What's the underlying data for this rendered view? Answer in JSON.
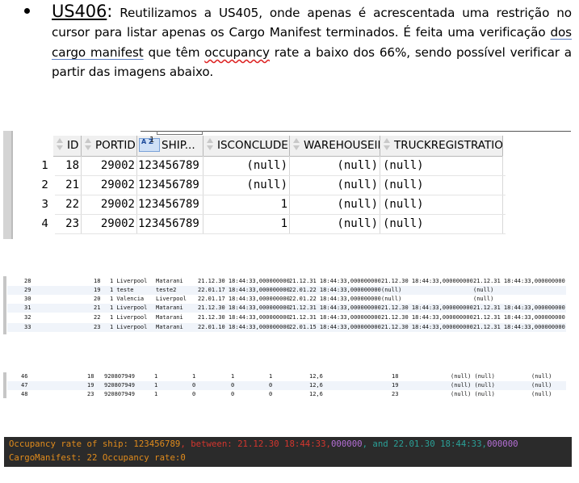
{
  "paragraph": {
    "story_id": "US406",
    "colon": ":",
    "t1": " Reutilizamos a US405, onde apenas é acrescentada uma restrição no cursor para listar apenas os Cargo Manifest terminados. É feita uma verificação ",
    "u1": "dos cargo manifest",
    "t2": " que têm ",
    "u2": "occupancy",
    "t3": " rate a baixo dos 66%, sendo possível verificar a partir das imagens abaixo."
  },
  "grid1": {
    "headers": [
      "ID",
      "PORTID",
      "SHIP...",
      "ISCONCLUDED",
      "WAREHOUSEID",
      "TRUCKREGISTRATION"
    ],
    "sort_badge": "A Z",
    "sort_index": "1",
    "rows": [
      {
        "num": "1",
        "id": "18",
        "portid": "29002",
        "ship": "123456789",
        "isconcluded": "(null)",
        "warehouseid": "(null)",
        "truck": "(null)"
      },
      {
        "num": "2",
        "id": "21",
        "portid": "29002",
        "ship": "123456789",
        "isconcluded": "(null)",
        "warehouseid": "(null)",
        "truck": "(null)"
      },
      {
        "num": "3",
        "id": "22",
        "portid": "29002",
        "ship": "123456789",
        "isconcluded": "1",
        "warehouseid": "(null)",
        "truck": "(null)"
      },
      {
        "num": "4",
        "id": "23",
        "portid": "29002",
        "ship": "123456789",
        "isconcluded": "1",
        "warehouseid": "(null)",
        "truck": "(null)"
      }
    ]
  },
  "grid2": {
    "rows": [
      {
        "n": "28",
        "a": "18",
        "b": "1 Liverpool",
        "c": "Matarani",
        "d": "21.12.30 18:44:33,000000000",
        "e": "21.12.31 18:44:33,000000000",
        "f": "21.12.30 18:44:33,000000000",
        "g": "21.12.31 18:44:33,000000000"
      },
      {
        "n": "29",
        "a": "19",
        "b": "1 teste",
        "c": "teste2",
        "d": "22.01.17 18:44:33,000000000",
        "e": "22.01.22 18:44:33,000000000",
        "f": "(null)",
        "g": "(null)"
      },
      {
        "n": "30",
        "a": "20",
        "b": "1 Valencia",
        "c": "Liverpool",
        "d": "22.01.17 18:44:33,000000000",
        "e": "22.01.22 18:44:33,000000000",
        "f": "(null)",
        "g": "(null)"
      },
      {
        "n": "31",
        "a": "21",
        "b": "1 Liverpool",
        "c": "Matarani",
        "d": "21.12.30 18:44:33,000000000",
        "e": "21.12.31 18:44:33,000000000",
        "f": "21.12.30 18:44:33,000000000",
        "g": "21.12.31 18:44:33,000000000"
      },
      {
        "n": "32",
        "a": "22",
        "b": "1 Liverpool",
        "c": "Matarani",
        "d": "21.12.30 18:44:33,000000000",
        "e": "21.12.31 18:44:33,000000000",
        "f": "21.12.30 18:44:33,000000000",
        "g": "21.12.31 18:44:33,000000000"
      },
      {
        "n": "33",
        "a": "23",
        "b": "1 Liverpool",
        "c": "Matarani",
        "d": "22.01.10 18:44:33,000000000",
        "e": "22.01.15 18:44:33,000000000",
        "f": "21.12.30 18:44:33,000000000",
        "g": "21.12.31 18:44:33,000000000"
      }
    ]
  },
  "grid3": {
    "rows": [
      {
        "n": "46",
        "a": "18",
        "b": "920807949",
        "c": "1",
        "d": "1",
        "e": "1",
        "f": "1",
        "g": "12,6",
        "h": "18",
        "i": "(null) (null)",
        "j": "(null)"
      },
      {
        "n": "47",
        "a": "19",
        "b": "920807949",
        "c": "1",
        "d": "0",
        "e": "0",
        "f": "0",
        "g": "12,6",
        "h": "19",
        "i": "(null) (null)",
        "j": "(null)"
      },
      {
        "n": "48",
        "a": "23",
        "b": "920807949",
        "c": "1",
        "d": "0",
        "e": "0",
        "f": "0",
        "g": "12,6",
        "h": "23",
        "i": "(null) (null)",
        "j": "(null)"
      }
    ]
  },
  "console": {
    "l1_a": "Occupancy rate of ship: 123456789",
    "l1_b": ", between: 21.12.30 18:44:33,",
    "l1_c": "000000",
    "l1_d": ", and 22.01.30 18:44:33,",
    "l1_e": "000000",
    "l2": "CargoManifest: 22 Occupancy rate:0",
    "colors": {
      "orange": "#e08b1c",
      "red": "#d4362e",
      "purple": "#b56fd6",
      "teal": "#2aa198",
      "bg": "#2b2b2b"
    }
  }
}
